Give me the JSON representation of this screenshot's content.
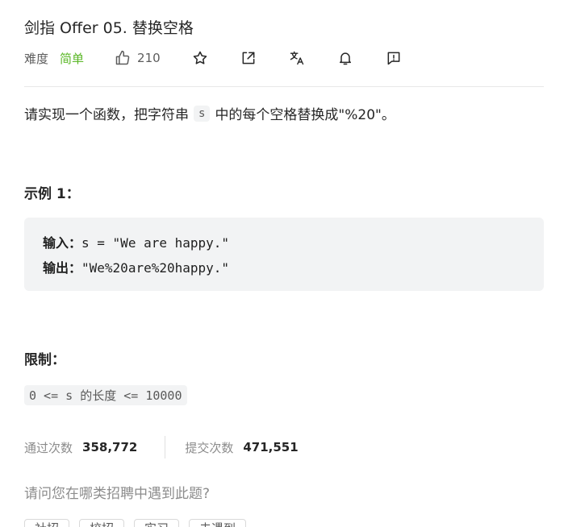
{
  "problem": {
    "title": "剑指 Offer 05. 替换空格",
    "difficulty_label": "难度",
    "difficulty": "简单",
    "likes": "210"
  },
  "description": {
    "before": "请实现一个函数，把字符串",
    "code": "s",
    "after": "中的每个空格替换成\"%20\"。"
  },
  "example": {
    "heading": "示例 1：",
    "input_label": "输入：",
    "input_value": "s = \"We are happy.\"",
    "output_label": "输出：",
    "output_value": "\"We%20are%20happy.\""
  },
  "constraints": {
    "heading": "限制：",
    "text": "0 <= s 的长度 <= 10000"
  },
  "stats": {
    "accepted_label": "通过次数",
    "accepted_value": "358,772",
    "submitted_label": "提交次数",
    "submitted_value": "471,551"
  },
  "interview": {
    "question": "请问您在哪类招聘中遇到此题?",
    "tags": [
      "社招",
      "校招",
      "实习",
      "未遇到"
    ]
  },
  "colors": {
    "easy": "#5ab726",
    "text": "#262626",
    "muted": "#8c8c8c",
    "code_bg": "#f2f3f4"
  },
  "icons": [
    "thumbs-up-icon",
    "star-icon",
    "share-icon",
    "translate-icon",
    "bell-icon",
    "feedback-icon"
  ]
}
